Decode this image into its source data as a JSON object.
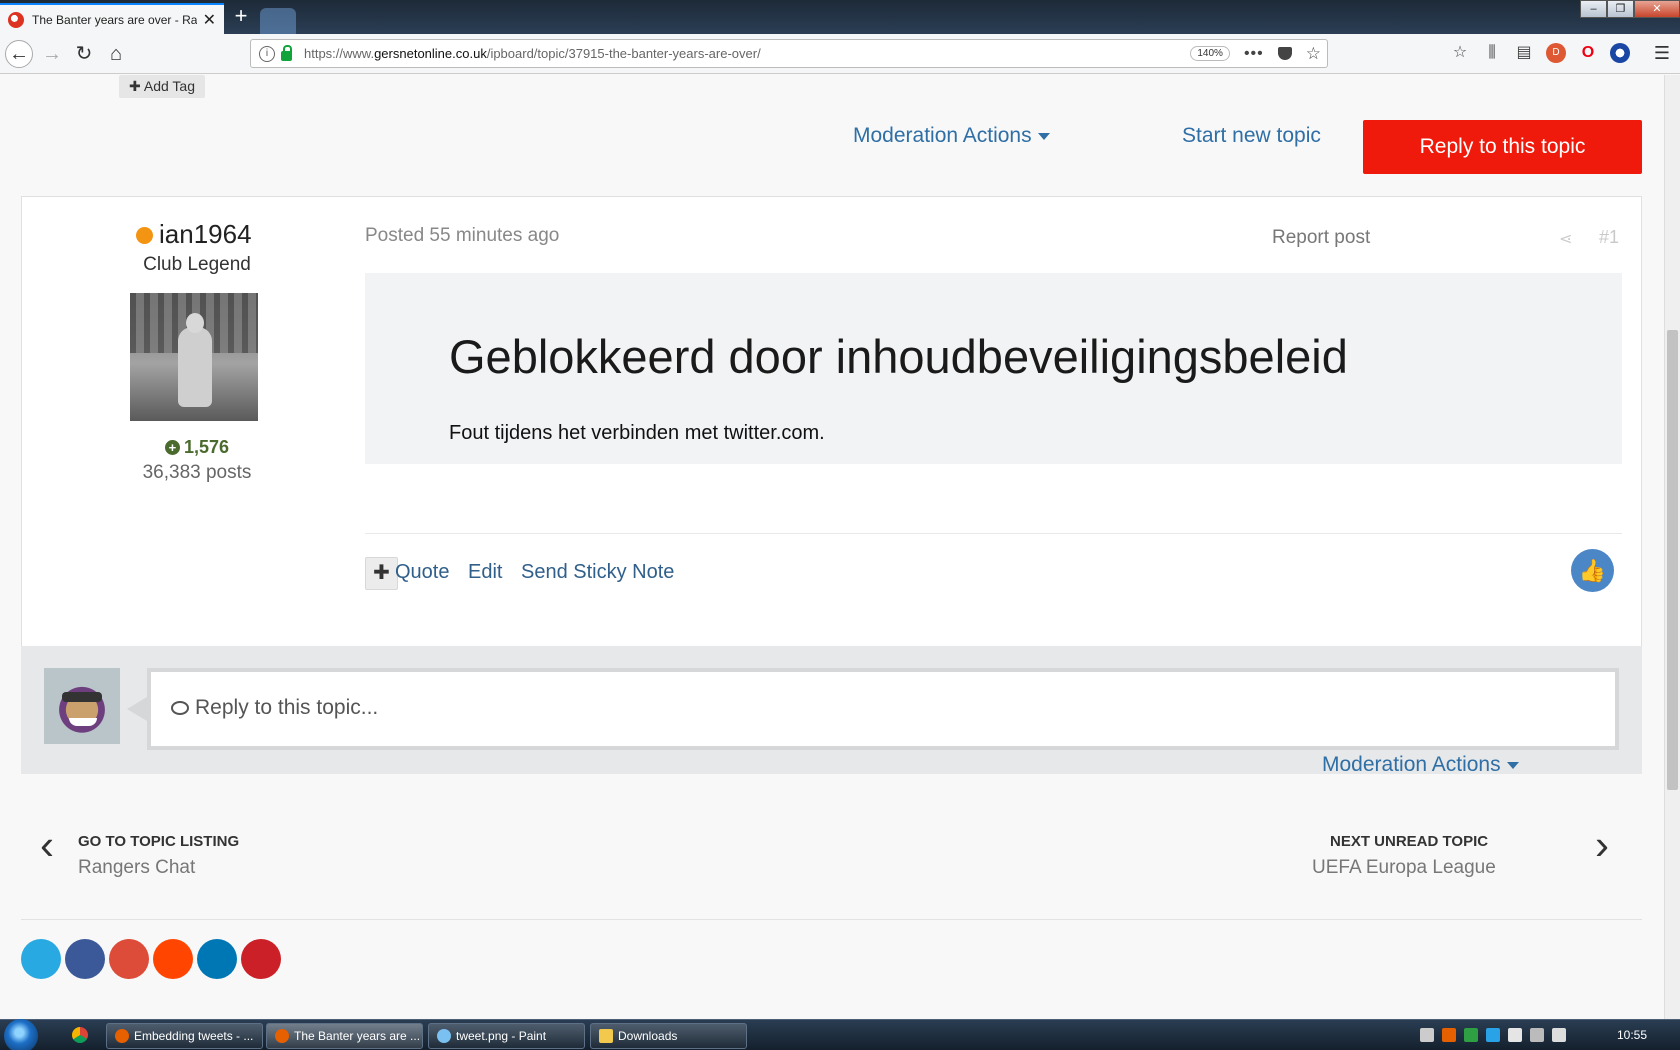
{
  "browser": {
    "tab_title": "The Banter years are over - Ran",
    "url_prefix": "https://www.",
    "url_host": "gersnetonline.co.uk",
    "url_path": "/ipboard/topic/37915-the-banter-years-are-over/",
    "zoom": "140%"
  },
  "page": {
    "add_tag": "Add Tag",
    "moderation_actions": "Moderation Actions",
    "start_new_topic": "Start new topic",
    "reply_to_topic": "Reply to this topic",
    "post": {
      "author": "ian1964",
      "rank": "Club Legend",
      "reputation": "1,576",
      "post_count": "36,383 posts",
      "posted": "Posted 55 minutes ago",
      "report": "Report post",
      "number": "#1",
      "embed_title": "Geblokkeerd door inhoudbeveiligingsbeleid",
      "embed_message": "Fout tijdens het verbinden met twitter.com.",
      "actions": {
        "quote": "Quote",
        "edit": "Edit",
        "sticky_note": "Send Sticky Note"
      }
    },
    "reply_placeholder": "Reply to this topic...",
    "nav": {
      "prev_label": "GO TO TOPIC LISTING",
      "prev_sub": "Rangers Chat",
      "next_label": "NEXT UNREAD TOPIC",
      "next_sub": "UEFA Europa League"
    }
  },
  "taskbar": {
    "items": [
      "Embedding tweets - ...",
      "The Banter years are ...",
      "tweet.png - Paint",
      "Downloads"
    ],
    "clock": "10:55"
  },
  "colors": {
    "accent_link": "#2f6fa5",
    "reply_button": "#ef1a0b",
    "online_dot": "#f39512",
    "reputation": "#4a6b2d",
    "like_button": "#4b86c6"
  }
}
